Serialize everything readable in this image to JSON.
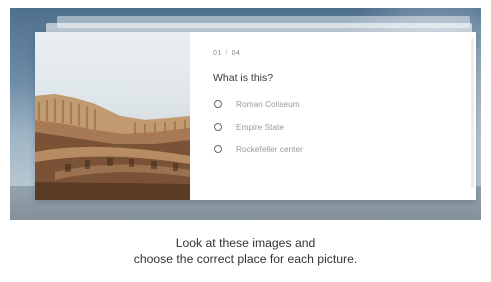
{
  "quiz": {
    "current": "01",
    "separator": "/",
    "total": "04",
    "question": "What is this?",
    "options": [
      {
        "label": "Roman Coliseum",
        "selected": false
      },
      {
        "label": "Empire State",
        "selected": false
      },
      {
        "label": "Rockefeller center",
        "selected": false
      }
    ]
  },
  "caption": {
    "line1": "Look at these images and",
    "line2": "choose the correct place for each picture."
  },
  "colors": {
    "text": "#3a3a3a",
    "muted": "#9a9a9a",
    "hero": "#6f8ca6"
  }
}
